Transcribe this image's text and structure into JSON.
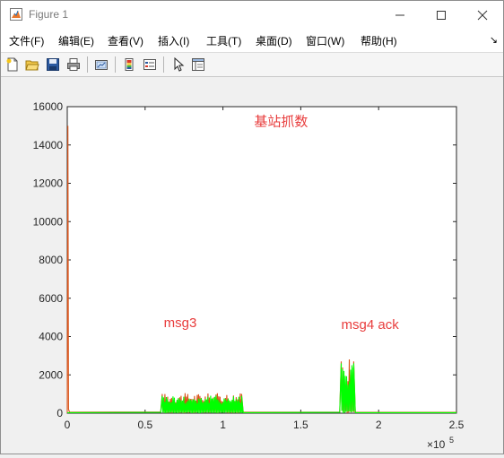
{
  "window": {
    "title": "Figure 1"
  },
  "menu": {
    "items": [
      "文件(F)",
      "编辑(E)",
      "查看(V)",
      "插入(I)",
      "工具(T)",
      "桌面(D)",
      "窗口(W)",
      "帮助(H)"
    ],
    "overflow_glyph": "↘"
  },
  "toolbar": {
    "icons": [
      "new-figure-icon",
      "open-file-icon",
      "save-icon",
      "print-icon",
      "link-plot-icon",
      "insert-colorbar-icon",
      "insert-legend-icon",
      "pointer-icon",
      "property-editor-icon"
    ]
  },
  "colors": {
    "series_orange": "#d95319",
    "series_green": "#00ff00",
    "annotation_red": "#e83c3c"
  },
  "chart_data": {
    "type": "line",
    "title": "",
    "xlabel": "",
    "ylabel": "",
    "x_exponent_label": "×10",
    "x_exponent": "5",
    "xlim": [
      0,
      250000
    ],
    "ylim": [
      0,
      16000
    ],
    "xticks": [
      0,
      50000,
      100000,
      150000,
      200000,
      250000
    ],
    "xtick_labels": [
      "0",
      "0.5",
      "1",
      "1.5",
      "2",
      "2.5"
    ],
    "yticks": [
      0,
      2000,
      4000,
      6000,
      8000,
      10000,
      12000,
      14000,
      16000
    ],
    "ytick_labels": [
      "0",
      "2000",
      "4000",
      "6000",
      "8000",
      "10000",
      "12000",
      "14000",
      "16000"
    ],
    "grid": false,
    "series": [
      {
        "color": "#d95319",
        "points": [
          [
            0,
            0
          ],
          [
            400,
            15000
          ],
          [
            800,
            200
          ],
          [
            1500,
            50
          ],
          [
            60000,
            60
          ],
          [
            61000,
            1000
          ],
          [
            112000,
            1000
          ],
          [
            113000,
            50
          ],
          [
            175000,
            50
          ],
          [
            176000,
            2700
          ],
          [
            184000,
            2700
          ],
          [
            185000,
            50
          ],
          [
            250000,
            40
          ]
        ]
      },
      {
        "color": "#00ff00",
        "points": [
          [
            0,
            30
          ],
          [
            60000,
            40
          ],
          [
            61000,
            900
          ],
          [
            112000,
            900
          ],
          [
            113000,
            30
          ],
          [
            175000,
            40
          ],
          [
            176000,
            2600
          ],
          [
            184000,
            2600
          ],
          [
            185000,
            30
          ],
          [
            250000,
            30
          ]
        ]
      }
    ],
    "annotations": [
      {
        "text": "基站抓数",
        "x": 120000,
        "y": 15000
      },
      {
        "text": "msg3",
        "x": 62000,
        "y": 4500
      },
      {
        "text": "msg4 ack",
        "x": 176000,
        "y": 4400
      }
    ]
  }
}
